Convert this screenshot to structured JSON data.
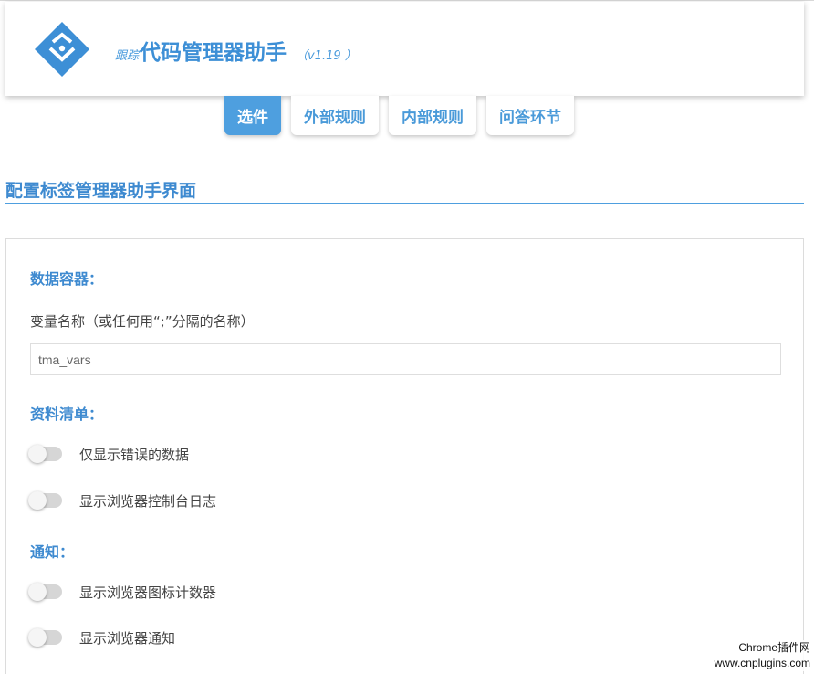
{
  "header": {
    "title_prefix": "跟踪",
    "title_main": "代码管理器助手",
    "version": "（v1.19 ）",
    "accent_color": "#3d8fd6",
    "logo_icon": "diamond-chevron-logo-icon"
  },
  "tabs": [
    {
      "label": "选件",
      "active": true
    },
    {
      "label": "外部规则",
      "active": false
    },
    {
      "label": "内部规则",
      "active": false
    },
    {
      "label": "问答环节",
      "active": false
    }
  ],
  "section": {
    "title": "配置标签管理器助手界面"
  },
  "data_container": {
    "title": "数据容器：",
    "field_label": "变量名称（或任何用“;”分隔的名称）",
    "input_value": "tma_vars"
  },
  "data_list": {
    "title": "资料清单：",
    "toggles": [
      {
        "label": "仅显示错误的数据",
        "on": false
      },
      {
        "label": "显示浏览器控制台日志",
        "on": false
      }
    ]
  },
  "notifications": {
    "title": "通知：",
    "toggles": [
      {
        "label": "显示浏览器图标计数器",
        "on": false
      },
      {
        "label": "显示浏览器通知",
        "on": false
      }
    ]
  },
  "watermark": {
    "line1": "Chrome插件网",
    "line2": "www.cnplugins.com"
  }
}
